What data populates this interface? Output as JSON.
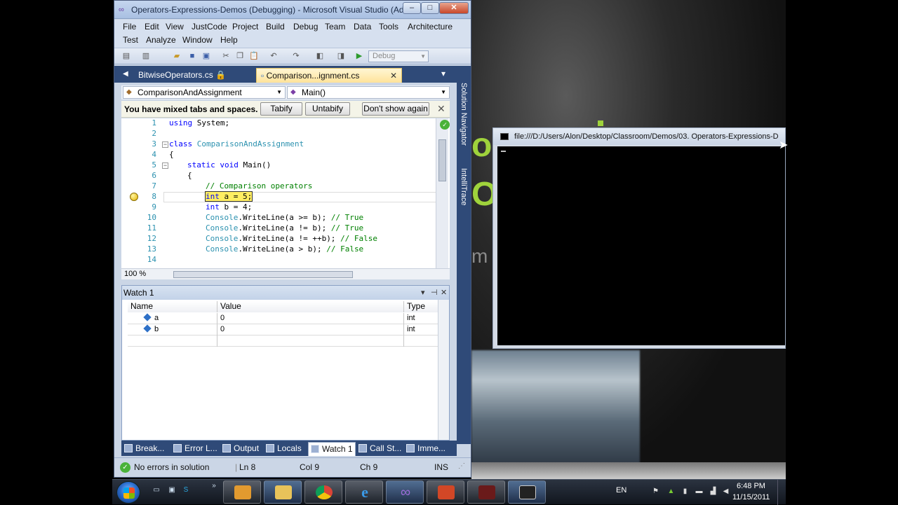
{
  "vs": {
    "title": "Operators-Expressions-Demos (Debugging) - Microsoft Visual Studio (Ad...",
    "window_buttons": {
      "minimize": "–",
      "maximize": "□",
      "close": "✕"
    },
    "menu_row1": [
      "File",
      "Edit",
      "View",
      "JustCode",
      "Project",
      "Build",
      "Debug",
      "Team",
      "Data",
      "Tools",
      "Architecture"
    ],
    "menu_row2": [
      "Test",
      "Analyze",
      "Window",
      "Help"
    ],
    "toolbar": {
      "config": "Debug"
    },
    "tabs": {
      "bitwise": "BitwiseOperators.cs",
      "comparison": "Comparison...ignment.cs",
      "close_glyph": "✕"
    },
    "nav": {
      "class_combo": "ComparisonAndAssignment",
      "method_combo": "Main()"
    },
    "tabs_bar": {
      "message": "You have mixed tabs and spaces. Fix",
      "tabify": "Tabify",
      "untabify": "Untabify",
      "dont_show": "Don't show again",
      "close": "✕"
    },
    "editor": {
      "line_numbers": [
        "1",
        "2",
        "3",
        "4",
        "5",
        "6",
        "7",
        "8",
        "9",
        "10",
        "11",
        "12",
        "13",
        "14"
      ],
      "code": {
        "l1_kw": "using",
        "l1_rest": " System;",
        "l3_kw": "class",
        "l3_type": " ComparisonAndAssignment",
        "l4": "{",
        "l5_kw1": "static",
        "l5_kw2": " void",
        "l5_rest": " Main()",
        "l6": "{",
        "l7_comment": "// Comparison operators",
        "l8_kw": "int",
        "l8_rest": " a = 5;",
        "l9_kw": "int",
        "l9_rest": " b = 4;",
        "l10_type": "Console",
        "l10_rest": ".WriteLine(a >= b); ",
        "l10_comment": "// True",
        "l11_type": "Console",
        "l11_rest": ".WriteLine(a != b); ",
        "l11_comment": "// True",
        "l12_type": "Console",
        "l12_rest": ".WriteLine(a != ++b); ",
        "l12_comment": "// False",
        "l13_type": "Console",
        "l13_rest": ".WriteLine(a > b); ",
        "l13_comment": "// False"
      },
      "zoom": "100 %"
    },
    "watch": {
      "title": "Watch 1",
      "columns": [
        "Name",
        "Value",
        "Type"
      ],
      "rows": [
        {
          "name": "a",
          "value": "0",
          "type": "int"
        },
        {
          "name": "b",
          "value": "0",
          "type": "int"
        }
      ]
    },
    "tool_tabs": [
      "Break...",
      "Error L...",
      "Output",
      "Locals",
      "Watch 1",
      "Call St...",
      "Imme..."
    ],
    "status": {
      "message": "No errors in solution",
      "line": "Ln 8",
      "col": "Col 9",
      "ch": "Ch 9",
      "ins": "INS"
    },
    "side_panels": [
      "Solution Navigator",
      "IntelliTrace"
    ]
  },
  "console": {
    "title": "file:///D:/Users/Alon/Desktop/Classroom/Demos/03. Operators-Expressions-D"
  },
  "taskbar": {
    "language": "EN",
    "time": "6:48 PM",
    "date": "11/15/2011"
  },
  "colors": {
    "vs_chrome": "#cbd6e6",
    "vs_tab_strip": "#2f4a78",
    "active_tab": "#ffe39a",
    "current_statement": "#ffee62",
    "keyword": "#0000ff",
    "type": "#2b91af",
    "comment": "#008000",
    "wallpaper_green": "#9fd33c"
  }
}
